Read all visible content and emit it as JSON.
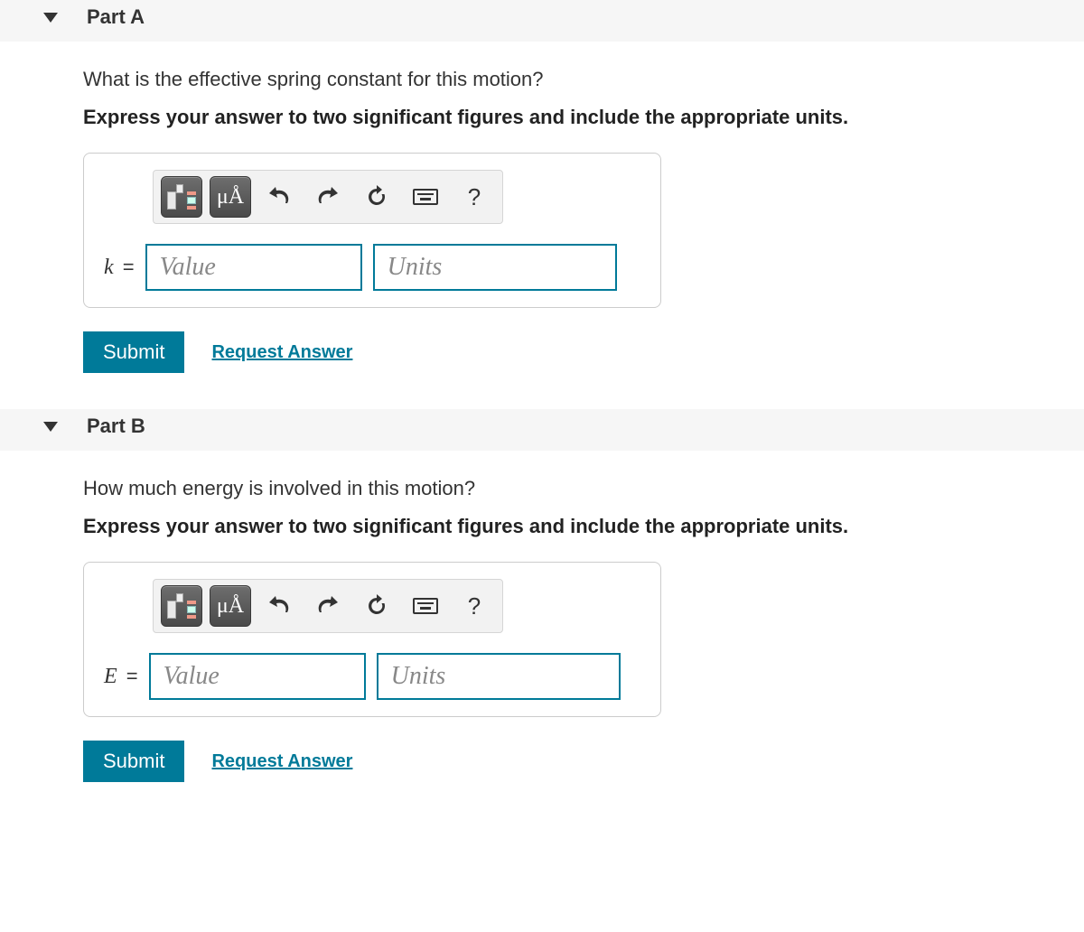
{
  "parts": [
    {
      "title": "Part A",
      "question": "What is the effective spring constant for this motion?",
      "instruction": "Express your answer to two significant figures and include the appropriate units.",
      "variable": "k",
      "value_placeholder": "Value",
      "units_placeholder": "Units",
      "submit": "Submit",
      "request": "Request Answer",
      "special_chars": "μÅ"
    },
    {
      "title": "Part B",
      "question": "How much energy is involved in this motion?",
      "instruction": "Express your answer to two significant figures and include the appropriate units.",
      "variable": "E",
      "value_placeholder": "Value",
      "units_placeholder": "Units",
      "submit": "Submit",
      "request": "Request Answer",
      "special_chars": "μÅ"
    }
  ],
  "icons": {
    "help": "?",
    "undo": "↶",
    "redo": "↷",
    "refresh": "⟳"
  }
}
